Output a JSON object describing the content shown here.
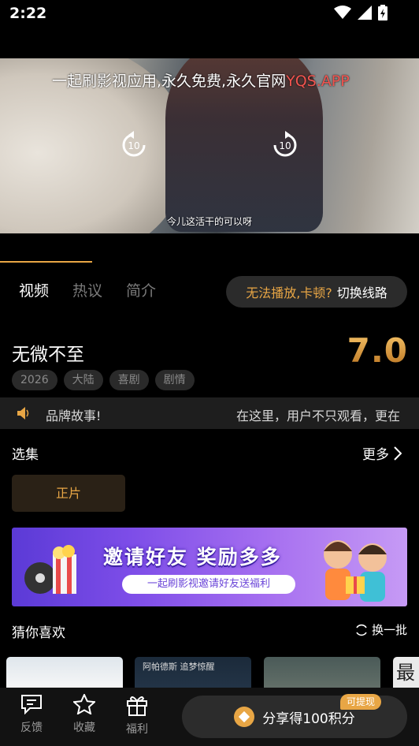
{
  "status_bar": {
    "time": "2:22"
  },
  "player": {
    "watermark_text": "一起刷影视应用,永久免费,永久官网",
    "watermark_url": "YQS.APP",
    "seek_back_label": "10",
    "seek_forward_label": "10",
    "subtitle": "今儿这活干的可以呀",
    "progress_fraction": 0.22
  },
  "tabs": [
    {
      "label": "视频",
      "active": true
    },
    {
      "label": "热议",
      "active": false
    },
    {
      "label": "简介",
      "active": false
    }
  ],
  "switch_line": {
    "question": "无法播放,卡顿?",
    "action": "切换线路"
  },
  "movie": {
    "title": "无微不至",
    "rating": "7.0",
    "tags": [
      "2026",
      "大陆",
      "喜剧",
      "剧情"
    ]
  },
  "notice": {
    "text_left": "品牌故事!",
    "text_right": "在这里，用户不只观看，更在"
  },
  "episodes": {
    "section_title": "选集",
    "more_label": "更多",
    "items": [
      "正片"
    ]
  },
  "banner": {
    "title": "邀请好友 奖励多多",
    "subtitle": "一起刷影视邀请好友送福利"
  },
  "recommend": {
    "section_title": "猜你喜欢",
    "refresh_label": "换一批",
    "poster2_caption": "阿帕德斯  追梦惊醒",
    "poster4_caption": "最"
  },
  "bottom_bar": {
    "items": [
      {
        "label": "反馈",
        "icon": "chat-icon"
      },
      {
        "label": "收藏",
        "icon": "star-icon"
      },
      {
        "label": "福利",
        "icon": "gift-icon"
      }
    ],
    "share_label": "分享得100积分",
    "withdraw_badge": "可提现"
  },
  "colors": {
    "accent": "#e8a645",
    "background": "#000000",
    "tag_bg": "#2a2a2a"
  }
}
